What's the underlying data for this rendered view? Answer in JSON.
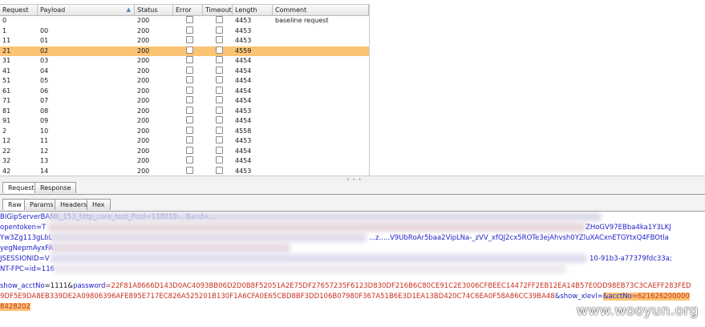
{
  "table": {
    "columns": [
      "Request",
      "Payload",
      "Status",
      "Error",
      "Timeout",
      "Length",
      "Comment"
    ],
    "rows": [
      {
        "request": "0",
        "payload": "",
        "status": "200",
        "length": "4453",
        "comment": "baseline request"
      },
      {
        "request": "1",
        "payload": "00",
        "status": "200",
        "length": "4453",
        "comment": ""
      },
      {
        "request": "11",
        "payload": "01",
        "status": "200",
        "length": "4453",
        "comment": ""
      },
      {
        "request": "21",
        "payload": "02",
        "status": "200",
        "length": "4559",
        "comment": "",
        "selected": true
      },
      {
        "request": "31",
        "payload": "03",
        "status": "200",
        "length": "4454",
        "comment": ""
      },
      {
        "request": "41",
        "payload": "04",
        "status": "200",
        "length": "4454",
        "comment": ""
      },
      {
        "request": "51",
        "payload": "05",
        "status": "200",
        "length": "4454",
        "comment": ""
      },
      {
        "request": "61",
        "payload": "06",
        "status": "200",
        "length": "4454",
        "comment": ""
      },
      {
        "request": "71",
        "payload": "07",
        "status": "200",
        "length": "4454",
        "comment": ""
      },
      {
        "request": "81",
        "payload": "08",
        "status": "200",
        "length": "4453",
        "comment": ""
      },
      {
        "request": "91",
        "payload": "09",
        "status": "200",
        "length": "4454",
        "comment": ""
      },
      {
        "request": "2",
        "payload": "10",
        "status": "200",
        "length": "4558",
        "comment": ""
      },
      {
        "request": "12",
        "payload": "11",
        "status": "200",
        "length": "4453",
        "comment": ""
      },
      {
        "request": "22",
        "payload": "12",
        "status": "200",
        "length": "4454",
        "comment": ""
      },
      {
        "request": "32",
        "payload": "13",
        "status": "200",
        "length": "4454",
        "comment": ""
      },
      {
        "request": "42",
        "payload": "14",
        "status": "200",
        "length": "4453",
        "comment": ""
      }
    ]
  },
  "tabs_main": [
    "Request",
    "Response"
  ],
  "tabs_sub": [
    "Raw",
    "Params",
    "Headers",
    "Hex"
  ],
  "editor": {
    "line1": "BIGipServerBANK_153_http_core_test_Pool=138019... Band=...",
    "line2_prefix": "opentoken=T",
    "line2_tail": "ZHoGV97EBba4ka1Y3LKJ",
    "line3_prefix": "Yw3Zg113gLbL",
    "line3_mid": "...z.....V9UbRoAr5baa2VipLNa-_zVV_xfQJ2cx5ROTe3ejAhvsh0YZluXACxnETGYtxQ4FBOtla",
    "line4_prefix": "yegNepmAyxFA",
    "line5_prefix": "JSESSIONID=V",
    "line5_tail": "10-91b3-a77379fdc33a;",
    "line6_prefix": "NT-FPC=id=116",
    "post_k1": "show_acctNo",
    "post_v1": "=1111&",
    "post_k2": "password",
    "post_v2": "=22F81A8666D143D0AC4093BB06D2D0B8F52051A2E75DF27657235F6123D830DF216B6C80CE91C2E3006CFBEEC14472FF2EB12EA14B57E0DD98EB73C3CAEFF283FED",
    "post_line2a": "9DF5E9DA8EB339DE2A09806396AFE895E717EC826A525201B130F1A6CFA0E65CBD8BF3DD106B07980F367A51B6E3D1EA13BD420C74C6EA0F58A86CC39BA48",
    "post_k3": "&show_xlevl=",
    "post_k4": "&acctNo",
    "post_v4": "=621626200000",
    "post_line3": "8428202"
  },
  "watermark": "www.wooyun.org"
}
